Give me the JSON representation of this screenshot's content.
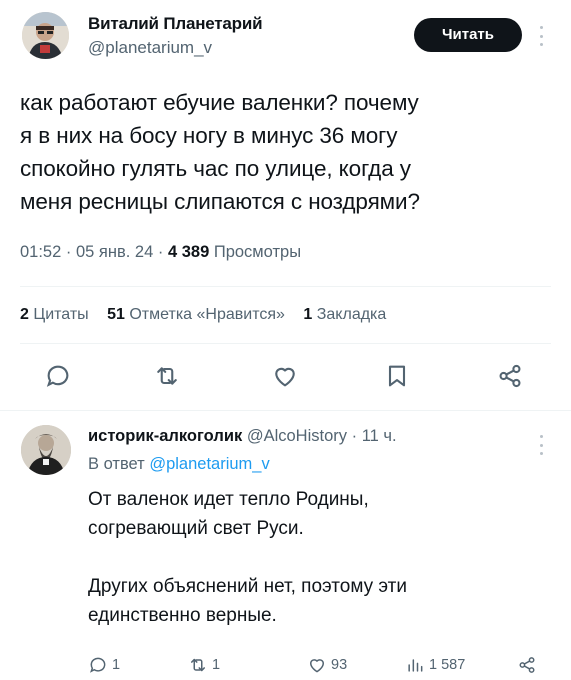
{
  "post": {
    "author_name": "Виталий Планетарий",
    "author_handle": "@planetarium_v",
    "follow_label": "Читать",
    "text_lines": [
      "как работают ебучие валенки? почему",
      "я в них на босу ногу в минус 36 могу",
      "спокойно гулять час по улице, когда у",
      "меня ресницы слипаются с ноздрями?"
    ],
    "time": "01:52",
    "date": "05 янв. 24",
    "views_count": "4 389",
    "views_label": "Просмотры",
    "quotes_count": "2",
    "quotes_label": "Цитаты",
    "likes_count": "51",
    "likes_label": "Отметка «Нравится»",
    "bookmarks_count": "1",
    "bookmarks_label": "Закладка"
  },
  "reply": {
    "author_name": "историк-алкоголик",
    "author_handle": "@AlcoHistory",
    "age": "11 ч.",
    "reply_to_prefix": "В ответ",
    "reply_to_handle": "@planetarium_v",
    "text_lines": [
      "От валенок идет тепло Родины,",
      "согревающий свет Руси.",
      "",
      "Других объяснений нет, поэтому эти",
      "единственно верные."
    ],
    "replies_count": "1",
    "reposts_count": "1",
    "likes_count": "93",
    "views_count": "1 587"
  },
  "icons": [
    "reply-icon",
    "repost-icon",
    "like-icon",
    "bookmark-icon",
    "share-icon",
    "views-icon",
    "more-icon"
  ],
  "colors": {
    "text": "#0f1419",
    "secondary": "#536471",
    "link": "#1d9bf0",
    "button": "#0f1419"
  }
}
